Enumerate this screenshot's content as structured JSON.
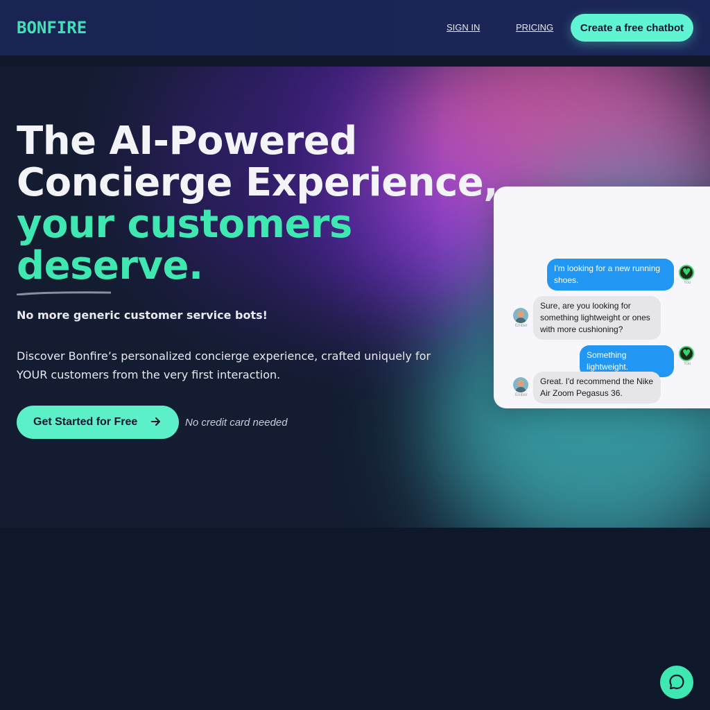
{
  "nav": {
    "logo": "BONFIRE",
    "signin": "SIGN IN",
    "pricing": "PRICING",
    "cta": "Create a free chatbot"
  },
  "hero": {
    "headline_line1": "The AI-Powered",
    "headline_line2": "Concierge Experience,",
    "headline_line3": "your customers",
    "headline_line4": "deserve.",
    "subheading": "No more generic customer service bots!",
    "description": "Discover Bonfire’s personalized concierge experience, crafted uniquely for YOUR customers from the very first interaction.",
    "cta": "Get Started for Free",
    "note": "No credit card needed"
  },
  "chat": {
    "messages": [
      {
        "from": "user",
        "text": "I'm looking for a new running shoes.",
        "label": "You"
      },
      {
        "from": "bot",
        "text": "Sure, are you looking for something lightweight or ones with more cushioning?",
        "label": "Ember"
      },
      {
        "from": "user",
        "text": "Something lightweight.",
        "label": "You"
      },
      {
        "from": "bot",
        "text": "Great. I'd recommend the Nike Air Zoom Pegasus 36.",
        "label": "Ember"
      }
    ]
  },
  "colors": {
    "accent": "#3ee8b0",
    "nav_bg": "#1a2452",
    "page_bg": "#0f172a",
    "user_bubble": "#2196f3",
    "bot_bubble": "#e5e5ea"
  },
  "icons": {
    "cta_arrow": "arrow-right-icon",
    "fab": "chat-bubble-icon"
  }
}
